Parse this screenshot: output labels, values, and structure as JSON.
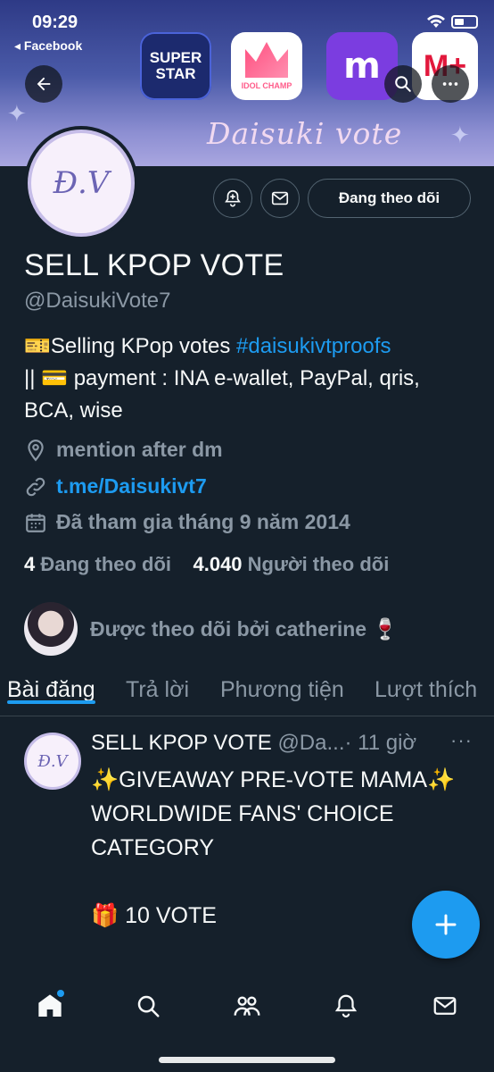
{
  "status_bar": {
    "time": "09:29",
    "back_app": "◂ Facebook"
  },
  "banner": {
    "apps": [
      {
        "name": "superstar",
        "label": "SUPER STAR"
      },
      {
        "name": "idol-champ",
        "label": "IDOL CHAMP"
      },
      {
        "name": "m-app",
        "label": "m"
      },
      {
        "name": "mnet-plus",
        "label": "M+"
      }
    ],
    "title": "Daisuki vote"
  },
  "profile": {
    "avatar_text": "Đ.V",
    "follow_button": "Đang theo dõi",
    "display_name": "SELL KPOP VOTE",
    "handle": "@DaisukiVote7",
    "bio_prefix": "🎫Selling KPop votes ",
    "bio_hashtag": "#daisukivtproofs",
    "bio_rest": "|| 💳 payment : INA e-wallet, PayPal, qris, BCA, wise",
    "location": "mention after dm",
    "link": "t.me/Daisukivt7",
    "joined": "Đã tham gia tháng 9 năm 2014",
    "following_count": "4",
    "following_label": "Đang theo dõi",
    "followers_count": "4.040",
    "followers_label": "Người theo dõi",
    "followed_by": "Được theo dõi bởi catherine 🍷"
  },
  "tabs": [
    "Bài đăng",
    "Trả lời",
    "Phương tiện",
    "Lượt thích"
  ],
  "post": {
    "author": "SELL KPOP VOTE",
    "handle": "@Da...",
    "time": "· 11 giờ",
    "more": "···",
    "body": "✨GIVEAWAY PRE-VOTE MAMA✨\nWORLDWIDE FANS' CHOICE CATEGORY\n\n🎁 10 VOTE"
  },
  "colors": {
    "accent": "#1d9bf0",
    "background": "#15202b",
    "muted": "#8b98a5"
  }
}
